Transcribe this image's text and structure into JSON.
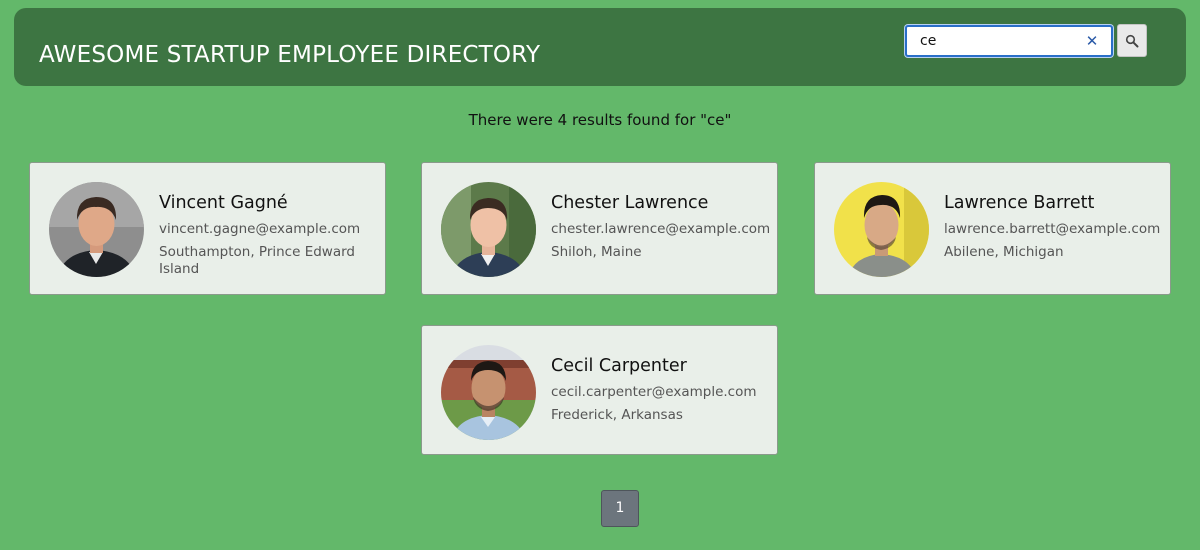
{
  "header": {
    "title": "AWESOME STARTUP EMPLOYEE DIRECTORY"
  },
  "search": {
    "value": "ce",
    "clear_label": "✕"
  },
  "results": {
    "summary": "There were 4 results found for \"ce\""
  },
  "employees": [
    {
      "name": "Vincent Gagné",
      "email": "vincent.gagne@example.com",
      "location": "Southampton, Prince Edward Island"
    },
    {
      "name": "Chester Lawrence",
      "email": "chester.lawrence@example.com",
      "location": "Shiloh, Maine"
    },
    {
      "name": "Lawrence Barrett",
      "email": "lawrence.barrett@example.com",
      "location": "Abilene, Michigan"
    },
    {
      "name": "Cecil Carpenter",
      "email": "cecil.carpenter@example.com",
      "location": "Frederick, Arkansas"
    }
  ],
  "pagination": {
    "current": "1"
  },
  "colors": {
    "page_bg": "#63b86a",
    "header_bg": "#3d7542",
    "card_bg": "#e9efe9",
    "page_button": "#6c757d"
  }
}
